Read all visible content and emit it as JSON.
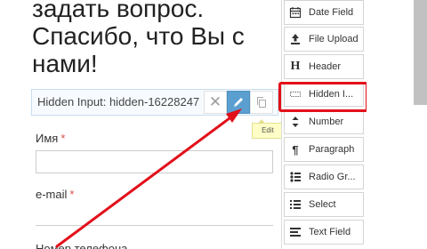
{
  "form": {
    "heading": "задать вопрос. Спасибо, что Вы с нами!",
    "hidden_input_text": "Hidden Input: hidden-16228247",
    "actions": {
      "delete_icon": "close-icon",
      "edit_icon": "pencil-icon",
      "copy_icon": "copy-icon",
      "edit_tooltip": "Edit"
    },
    "fields": [
      {
        "label": "Имя",
        "required": "*"
      },
      {
        "label": "e-mail",
        "required": "*"
      },
      {
        "label": "Номер телефона"
      }
    ]
  },
  "palette": {
    "items": [
      {
        "label": "Date Field",
        "icon": "calendar-icon"
      },
      {
        "label": "File Upload",
        "icon": "upload-icon"
      },
      {
        "label": "Header",
        "icon": "header-icon"
      },
      {
        "label": "Hidden I...",
        "icon": "hidden-input-icon"
      },
      {
        "label": "Number",
        "icon": "number-icon"
      },
      {
        "label": "Paragraph",
        "icon": "paragraph-icon"
      },
      {
        "label": "Radio Gr...",
        "icon": "radio-group-icon"
      },
      {
        "label": "Select",
        "icon": "select-icon"
      },
      {
        "label": "Text Field",
        "icon": "text-field-icon"
      }
    ]
  },
  "colors": {
    "annotation_red": "#e2101a",
    "edit_button_blue": "#5a9fd0",
    "tooltip_yellow": "#fffec7",
    "required_red": "#d9534f"
  }
}
